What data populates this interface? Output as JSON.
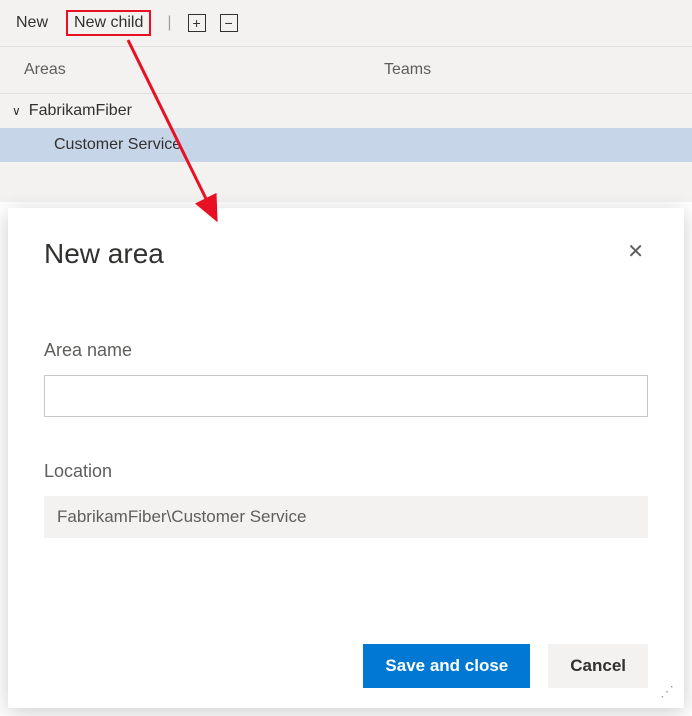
{
  "toolbar": {
    "new_label": "New",
    "new_child_label": "New child"
  },
  "tabs": {
    "areas": "Areas",
    "teams": "Teams"
  },
  "tree": {
    "root": "FabrikamFiber",
    "child": "Customer Service"
  },
  "dialog": {
    "title": "New area",
    "area_name_label": "Area name",
    "area_name_value": "",
    "location_label": "Location",
    "location_value": "FabrikamFiber\\Customer Service",
    "save_label": "Save and close",
    "cancel_label": "Cancel"
  }
}
